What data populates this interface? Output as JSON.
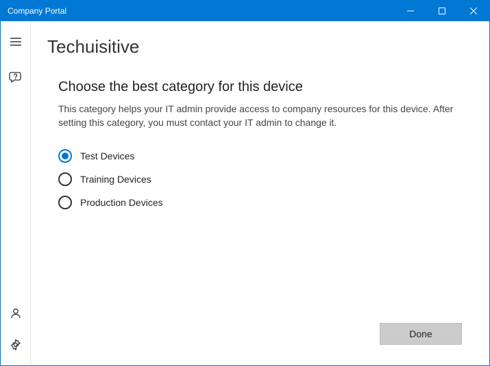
{
  "titlebar": {
    "title": "Company Portal"
  },
  "page": {
    "title": "Techuisitive"
  },
  "section": {
    "heading": "Choose the best category for this device",
    "description": "This category helps your IT admin provide access to company resources for this device. After setting this category, you must contact your IT admin to change it."
  },
  "categories": {
    "selected_index": 0,
    "options": [
      {
        "label": "Test Devices"
      },
      {
        "label": "Training Devices"
      },
      {
        "label": "Production Devices"
      }
    ]
  },
  "footer": {
    "done_label": "Done"
  }
}
